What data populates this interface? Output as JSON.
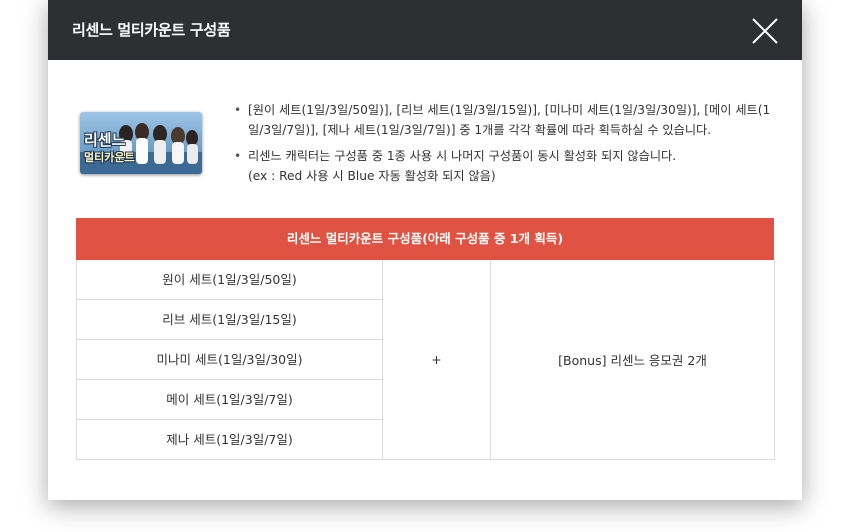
{
  "modal": {
    "title": "리센느 멀티카운트 구성품",
    "close_icon": "close-icon"
  },
  "thumbnail": {
    "label_line1": "리센느",
    "label_line2": "멀티카운트"
  },
  "description": {
    "bullet1": "[원이 세트(1일/3일/50일)], [리브 세트(1일/3일/15일)], [미나미 세트(1일/3일/30일)], [메이 세트(1일/3일/7일)], [제나 세트(1일/3일/7일)] 중 1개를 각각 확률에 따라 획득하실 수 있습니다.",
    "bullet2": "리센느 캐릭터는 구성품 중 1종 사용 시 나머지 구성품이 동시 활성화 되지 않습니다.",
    "bullet2_note": "(ex : Red 사용 시 Blue 자동 활성화 되지 않음)"
  },
  "table": {
    "header": "리센느 멀티카운트 구성품(아래 구성품 중 1개 획득)",
    "items": [
      "원이 세트(1일/3일/50일)",
      "리브 세트(1일/3일/15일)",
      "미나미 세트(1일/3일/30일)",
      "메이 세트(1일/3일/7일)",
      "제나 세트(1일/3일/7일)"
    ],
    "plus": "+",
    "bonus": "[Bonus] 리센느 응모권 2개"
  },
  "colors": {
    "header_bg": "#2d2f33",
    "table_header_bg": "#e05241"
  }
}
